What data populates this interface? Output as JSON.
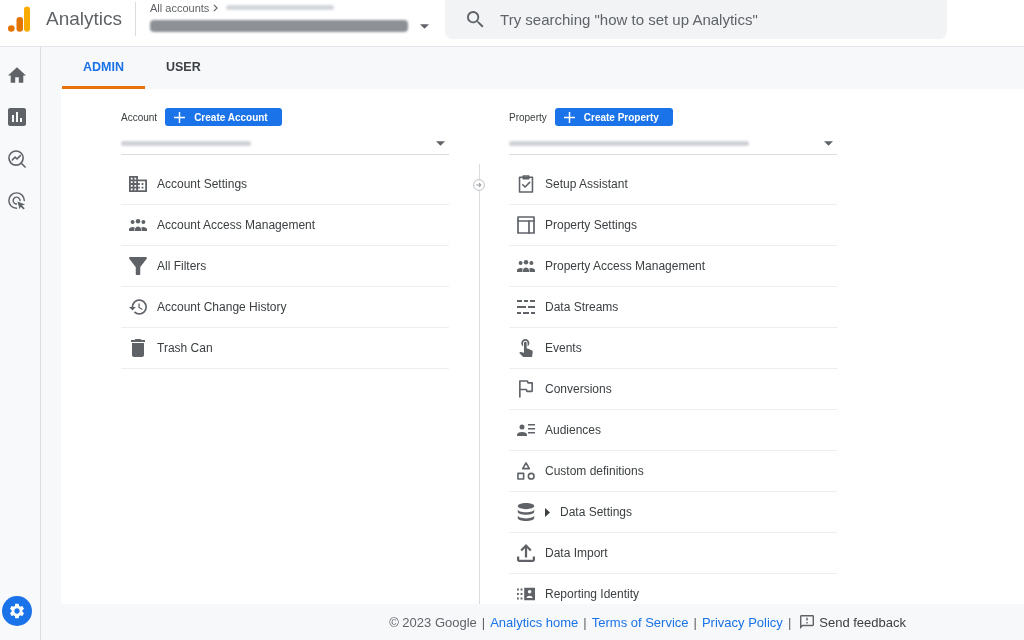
{
  "header": {
    "product_name": "Analytics",
    "breadcrumb": "All accounts",
    "search": {
      "placeholder": "Try searching \"how to set up Analytics\""
    }
  },
  "sidebar": {
    "nav": [
      {
        "selected": false
      },
      {
        "selected": false
      },
      {
        "selected": false
      },
      {
        "selected": false
      }
    ],
    "settings": {
      "selected": true
    }
  },
  "tabs": [
    {
      "label": "ADMIN",
      "selected": true
    },
    {
      "label": "USER",
      "selected": false
    }
  ],
  "account": {
    "label": "Account",
    "create_button": "Create Account",
    "items": [
      {
        "label": "Account Settings",
        "kind": "link"
      },
      {
        "label": "Account Access Management",
        "kind": "link"
      },
      {
        "label": "All Filters",
        "kind": "link"
      },
      {
        "label": "Account Change History",
        "kind": "link"
      },
      {
        "label": "Trash Can",
        "kind": "link"
      }
    ]
  },
  "property": {
    "label": "Property",
    "create_button": "Create Property",
    "items": [
      {
        "label": "Setup Assistant",
        "kind": "link"
      },
      {
        "label": "Property Settings",
        "kind": "link"
      },
      {
        "label": "Property Access Management",
        "kind": "link"
      },
      {
        "label": "Data Streams",
        "kind": "link"
      },
      {
        "label": "Events",
        "kind": "link"
      },
      {
        "label": "Conversions",
        "kind": "link"
      },
      {
        "label": "Audiences",
        "kind": "link"
      },
      {
        "label": "Custom definitions",
        "kind": "link"
      },
      {
        "label": "Data Settings",
        "kind": "group",
        "expanded": false
      },
      {
        "label": "Data Import",
        "kind": "link"
      },
      {
        "label": "Reporting Identity",
        "kind": "link"
      }
    ]
  },
  "footer": {
    "items": [
      {
        "kind": "text",
        "text": "© 2023 Google"
      },
      {
        "kind": "separator",
        "text": "|"
      },
      {
        "kind": "link",
        "text": "Analytics home"
      },
      {
        "kind": "separator",
        "text": "|"
      },
      {
        "kind": "link",
        "text": "Terms of Service"
      },
      {
        "kind": "separator",
        "text": "|"
      },
      {
        "kind": "link",
        "text": "Privacy Policy"
      },
      {
        "kind": "separator",
        "text": "|"
      },
      {
        "kind": "feedback",
        "text": "Send feedback"
      }
    ]
  }
}
